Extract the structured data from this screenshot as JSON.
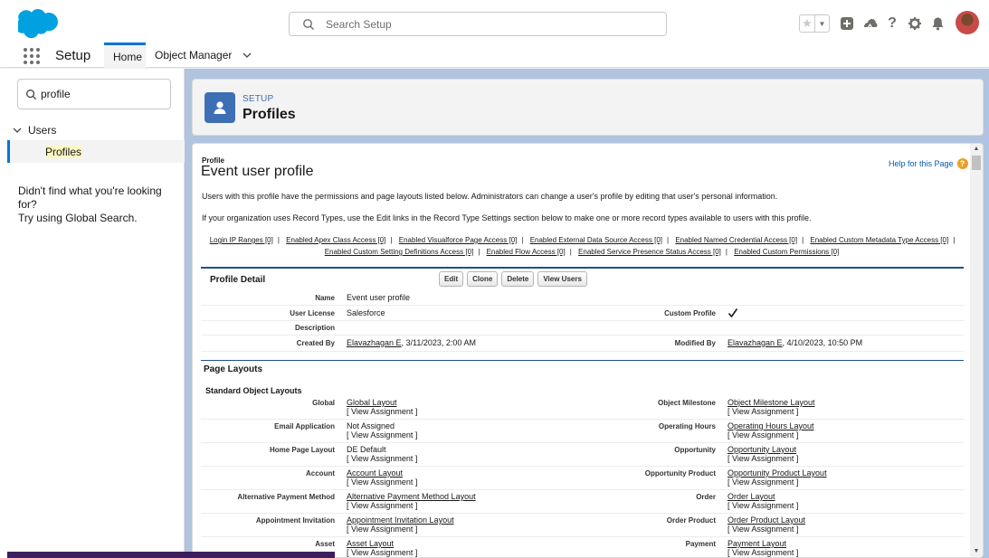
{
  "global_header": {
    "search_placeholder": "Search Setup",
    "icons": [
      "star-icon",
      "chevron-down-icon",
      "plus-icon",
      "trailhead-icon",
      "help-icon",
      "gear-icon",
      "bell-icon",
      "avatar"
    ]
  },
  "context_bar": {
    "app_name": "Setup",
    "tabs": [
      {
        "label": "Home",
        "active": true
      },
      {
        "label": "Object Manager",
        "active": false
      }
    ]
  },
  "sidebar": {
    "quick_find_value": "profile",
    "tree_group": "Users",
    "tree_item": "Profiles",
    "not_found_line1": "Didn't find what you're looking for?",
    "not_found_line2": "Try using Global Search."
  },
  "page_header": {
    "setup_label": "SETUP",
    "title": "Profiles"
  },
  "record": {
    "crumb": "Profile",
    "title": "Event user profile",
    "help_link": "Help for this Page",
    "paragraph1": "Users with this profile have the permissions and page layouts listed below. Administrators can change a user's profile by editing that user's personal information.",
    "paragraph2": "If your organization uses Record Types, use the Edit links in the Record Type Settings section below to make one or more record types available to users with this profile.",
    "related_links_row1": [
      "Login IP Ranges [0]",
      "Enabled Apex Class Access [0]",
      "Enabled Visualforce Page Access [0]",
      "Enabled External Data Source Access [0]",
      "Enabled Named Credential Access [0]",
      "Enabled Custom Metadata Type Access [0]"
    ],
    "related_links_row2": [
      "Enabled Custom Setting Definitions Access [0]",
      "Enabled Flow Access [0]",
      "Enabled Service Presence Status Access [0]",
      "Enabled Custom Permissions [0]"
    ],
    "separator": "|"
  },
  "profile_detail": {
    "heading": "Profile Detail",
    "buttons": [
      "Edit",
      "Clone",
      "Delete",
      "View Users"
    ],
    "name_label": "Name",
    "name_value": "Event user profile",
    "license_label": "User License",
    "license_value": "Salesforce",
    "custom_label": "Custom Profile",
    "custom_value": true,
    "description_label": "Description",
    "created_label": "Created By",
    "created_user": "Elavazhagan E",
    "created_date": ", 3/11/2023, 2:00 AM",
    "modified_label": "Modified By",
    "modified_user": "Elavazhagan E",
    "modified_date": ", 4/10/2023, 10:50 PM"
  },
  "page_layouts": {
    "heading": "Page Layouts",
    "subheading": "Standard Object Layouts",
    "view_assignment": "[ View Assignment ]",
    "left": [
      {
        "label": "Global",
        "value": "Global Layout",
        "link": true
      },
      {
        "label": "Email Application",
        "value": "Not Assigned",
        "link": false
      },
      {
        "label": "Home Page Layout",
        "value": "DE Default",
        "link": false
      },
      {
        "label": "Account",
        "value": "Account Layout",
        "link": true
      },
      {
        "label": "Alternative Payment Method",
        "value": "Alternative Payment Method Layout",
        "link": true
      },
      {
        "label": "Appointment Invitation",
        "value": "Appointment Invitation Layout",
        "link": true
      },
      {
        "label": "Asset",
        "value": "Asset Layout",
        "link": true
      }
    ],
    "right": [
      {
        "label": "Object Milestone",
        "value": "Object Milestone Layout",
        "link": true
      },
      {
        "label": "Operating Hours",
        "value": "Operating Hours Layout",
        "link": true
      },
      {
        "label": "Opportunity",
        "value": "Opportunity Layout",
        "link": true
      },
      {
        "label": "Opportunity Product",
        "value": "Opportunity Product Layout",
        "link": true
      },
      {
        "label": "Order",
        "value": "Order Layout",
        "link": true
      },
      {
        "label": "Order Product",
        "value": "Order Product Layout",
        "link": true
      },
      {
        "label": "Payment",
        "value": "Payment Layout",
        "link": true
      }
    ]
  },
  "colors": {
    "brand": "#0176d3",
    "header_icon": "#3e6fb5",
    "main_bg": "#b0c4df",
    "section_rule": "#1f4e8c"
  }
}
